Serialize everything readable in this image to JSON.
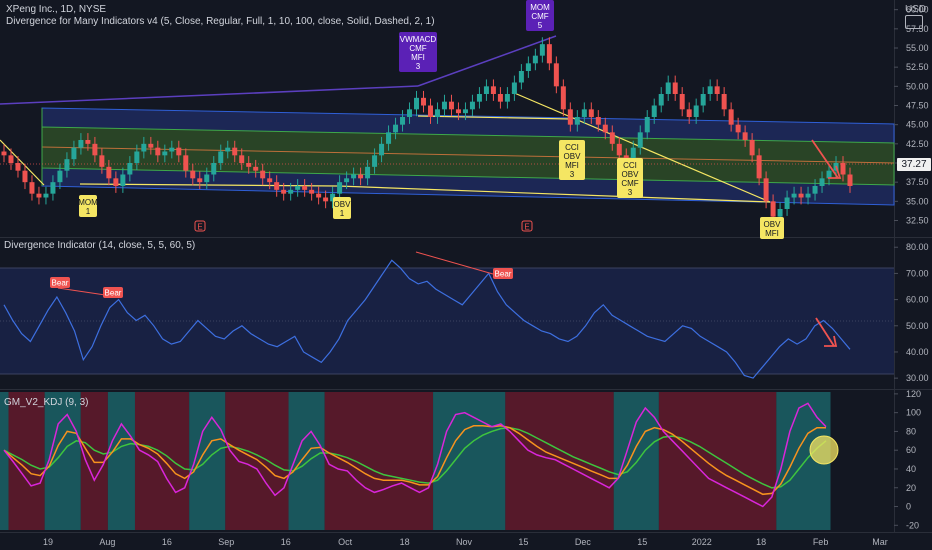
{
  "header": {
    "title": "XPeng Inc., 1D, NYSE",
    "indicator": "Divergence for Many Indicators v4 (5, Close, Regular, Full, 1, 10, 100, close, Solid, Dashed, 2, 1)",
    "currency": "USD"
  },
  "panes": [
    {
      "title": "Divergence Indicator (14, close, 5, 5, 60, 5)"
    },
    {
      "title": "GM_V2_KDJ (9, 3)"
    }
  ],
  "price_badge": "37.27",
  "colors": {
    "up": "#26a69a",
    "down": "#ef5350",
    "channel_blue": "#1e3a8a",
    "channel_green": "#2e5a1e",
    "divergence_line": "#f5e663",
    "purple_line": "#5b3fbf",
    "rsi_line": "#3d6fe0",
    "k_line": "#d926d9",
    "d_line": "#f7931e",
    "j_line": "#3ec43e"
  },
  "chart_data": [
    {
      "type": "candlestick",
      "title": "XPeng Inc., 1D, NYSE",
      "x_ticks": [
        "19",
        "Aug",
        "16",
        "Sep",
        "16",
        "Oct",
        "18",
        "Nov",
        "15",
        "Dec",
        "15",
        "2022",
        "18",
        "Feb",
        "Mar"
      ],
      "y_ticks": [
        32.5,
        35.0,
        37.5,
        40.0,
        42.5,
        45.0,
        47.5,
        50.0,
        52.5,
        55.0,
        57.5,
        60.0
      ],
      "ylim": [
        31.0,
        61.0
      ],
      "close_series": [
        41,
        40,
        39,
        37.5,
        36,
        35.5,
        36,
        37.5,
        39,
        40.5,
        42,
        43,
        42.5,
        41,
        39.5,
        38,
        37,
        38.5,
        40,
        41.5,
        42.5,
        42,
        41,
        41.5,
        42,
        41,
        39,
        38,
        37.5,
        38.5,
        40,
        41.5,
        42,
        41,
        40,
        39.5,
        39,
        38,
        37.5,
        36.5,
        36,
        36.5,
        37,
        36.5,
        36,
        35.5,
        35,
        36,
        37.5,
        38,
        38.5,
        38,
        39.5,
        41,
        42.5,
        44,
        45,
        46,
        47,
        48.5,
        47.5,
        46,
        47,
        48,
        47,
        46.5,
        47,
        48,
        49,
        50,
        49,
        48,
        49,
        50.5,
        52,
        53,
        54,
        55.5,
        53,
        50,
        47,
        45,
        46,
        47,
        46,
        45,
        44,
        42.5,
        41,
        40,
        42,
        44,
        46,
        47.5,
        49,
        50.5,
        49,
        47,
        46,
        47.5,
        49,
        50,
        49,
        47,
        45,
        44,
        43,
        41,
        38,
        35,
        33,
        34,
        35.5,
        36,
        35.5,
        36,
        37,
        38,
        39,
        40,
        38.5,
        37
      ],
      "annotations": [
        {
          "label": "MOM\n1"
        },
        {
          "label": "OBV\n1"
        },
        {
          "label": "VWMACD\nCMF\nMFI\n3"
        },
        {
          "label": "MOM\nCMF\n5"
        },
        {
          "label": "CCI\nOBV\nMFI\n3"
        },
        {
          "label": "CCI\nOBV\nCMF\n3"
        },
        {
          "label": "OBV\nMFI"
        }
      ],
      "markers": [
        "E",
        "E"
      ]
    },
    {
      "type": "line",
      "title": "Divergence Indicator (14, close, 5, 5, 60, 5)",
      "y_ticks": [
        30.0,
        40.0,
        50.0,
        60.0,
        70.0,
        80.0
      ],
      "ylim": [
        27,
        82
      ],
      "series": [
        {
          "values": [
            58,
            52,
            47,
            44,
            50,
            56,
            61,
            55,
            48,
            37,
            42,
            50,
            57,
            60,
            55,
            52,
            54,
            50,
            45,
            43,
            44,
            48,
            52,
            49,
            46,
            45,
            48,
            50,
            47,
            45,
            43,
            42,
            44,
            46,
            40,
            38,
            36,
            40,
            45,
            52,
            56,
            60,
            65,
            70,
            75,
            72,
            68,
            66,
            67,
            64,
            62,
            60,
            58,
            62,
            66,
            70,
            63,
            58,
            55,
            52,
            50,
            48,
            47,
            45,
            44,
            46,
            50,
            55,
            58,
            54,
            52,
            50,
            48,
            46,
            45,
            44,
            47,
            50,
            49,
            46,
            44,
            42,
            40,
            36,
            31,
            30,
            34,
            38,
            42,
            45,
            43,
            45,
            50,
            52,
            49,
            45,
            41
          ]
        }
      ],
      "annotations": [
        {
          "label": "Bear"
        },
        {
          "label": "Bear"
        },
        {
          "label": "Bear"
        }
      ]
    },
    {
      "type": "line",
      "title": "GM_V2_KDJ (9, 3)",
      "y_ticks": [
        -20,
        0,
        20,
        40,
        60,
        80,
        100,
        120
      ],
      "ylim": [
        -25,
        122
      ],
      "series": [
        {
          "values": [
            60,
            48,
            35,
            22,
            25,
            50,
            88,
            98,
            80,
            50,
            28,
            45,
            70,
            88,
            75,
            60,
            55,
            48,
            30,
            15,
            20,
            45,
            80,
            95,
            82,
            60,
            48,
            45,
            40,
            25,
            12,
            20,
            45,
            70,
            80,
            65,
            45,
            40,
            38,
            28,
            20,
            15,
            18,
            22,
            25,
            20,
            15,
            20,
            45,
            80,
            98,
            100,
            95,
            90,
            85,
            88,
            80,
            70,
            60,
            55,
            52,
            50,
            45,
            40,
            35,
            30,
            25,
            20,
            30,
            60,
            90,
            105,
            95,
            80,
            70,
            60,
            50,
            40,
            30,
            25,
            20,
            15,
            10,
            5,
            0,
            10,
            40,
            80,
            105,
            110,
            95,
            85
          ]
        },
        {
          "values": [
            60,
            52,
            44,
            35,
            33,
            43,
            65,
            80,
            78,
            62,
            47,
            47,
            58,
            72,
            72,
            66,
            62,
            56,
            46,
            35,
            30,
            37,
            55,
            70,
            72,
            66,
            60,
            55,
            50,
            42,
            33,
            30,
            37,
            50,
            62,
            63,
            57,
            52,
            47,
            41,
            35,
            30,
            28,
            28,
            28,
            26,
            23,
            23,
            32,
            52,
            70,
            82,
            86,
            86,
            85,
            86,
            84,
            78,
            71,
            64,
            58,
            54,
            50,
            46,
            42,
            38,
            34,
            30,
            30,
            44,
            64,
            80,
            84,
            82,
            77,
            70,
            62,
            54,
            46,
            39,
            33,
            28,
            23,
            18,
            13,
            14,
            24,
            42,
            62,
            78,
            84,
            84
          ]
        },
        {
          "values": [
            60,
            55,
            50,
            44,
            40,
            42,
            52,
            64,
            70,
            68,
            60,
            56,
            58,
            64,
            67,
            66,
            64,
            60,
            54,
            46,
            40,
            39,
            45,
            55,
            62,
            64,
            62,
            59,
            55,
            50,
            44,
            39,
            38,
            43,
            51,
            57,
            57,
            55,
            52,
            48,
            43,
            38,
            34,
            32,
            30,
            28,
            26,
            25,
            28,
            38,
            50,
            62,
            70,
            76,
            80,
            83,
            84,
            82,
            78,
            73,
            68,
            63,
            58,
            53,
            49,
            45,
            41,
            37,
            34,
            37,
            47,
            60,
            69,
            74,
            75,
            73,
            69,
            64,
            58,
            52,
            46,
            40,
            34,
            29,
            24,
            20,
            21,
            28,
            40,
            52,
            62,
            70
          ]
        }
      ]
    }
  ]
}
